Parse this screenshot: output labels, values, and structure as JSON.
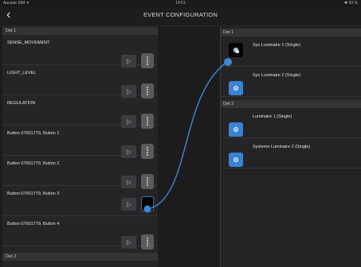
{
  "status_bar": {
    "carrier": "Aucune SIM ✦",
    "time": "14:51",
    "battery": "✱ 93 %"
  },
  "nav": {
    "back_glyph": "‹",
    "title": "EVENT CONFIGURATION"
  },
  "left_panel": {
    "sections": [
      {
        "header": "Det 1",
        "items": [
          {
            "label": "SENSE_MOVEMENT"
          },
          {
            "label": "LIGHT_LEVEL"
          },
          {
            "label": "REGULATION"
          },
          {
            "label": "Button 07001779, Button 1"
          },
          {
            "label": "Button 07001779, Button 2"
          },
          {
            "label": "Button 07001779, Button 3",
            "connected": true
          },
          {
            "label": "Button 07001779, Button 4"
          }
        ]
      },
      {
        "header": "Det 2",
        "items": []
      }
    ]
  },
  "right_panel": {
    "sections": [
      {
        "header": "Det 1",
        "items": [
          {
            "label": "Sys Luminaire 1 (Single)",
            "connected": true
          },
          {
            "label": "Sys Luminaire 2 (Single)"
          }
        ]
      },
      {
        "header": "Det 2",
        "items": [
          {
            "label": "Luminaire 1 (Single)"
          },
          {
            "label": "Systeme Luminaire 2 (Single)"
          }
        ]
      }
    ]
  },
  "colors": {
    "accent": "#3b82d1",
    "link_line": "#3d87d4",
    "background": "#1c1c1e"
  },
  "icons": {
    "play": "play-icon",
    "connector": "connector-handle-icon",
    "luminaire": "luminaire-icon"
  }
}
